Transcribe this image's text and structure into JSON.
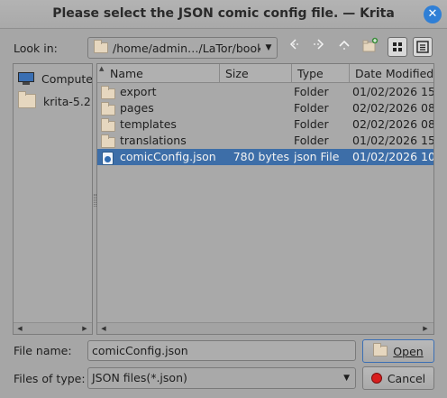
{
  "window": {
    "title": "Please select the JSON comic config file. — Krita",
    "close_glyph": "✕"
  },
  "lookin": {
    "label": "Look in:",
    "path": "/home/admin…/LaTor/book"
  },
  "toolbar": {
    "back": "‹",
    "forward": "›",
    "up": "⌃"
  },
  "places": [
    {
      "label": "Computer",
      "icon": "computer-icon"
    },
    {
      "label": "krita-5.2.",
      "icon": "folder-icon"
    }
  ],
  "columns": {
    "name": "Name",
    "size": "Size",
    "type": "Type",
    "date": "Date Modified"
  },
  "files": [
    {
      "name": "export",
      "size": "",
      "type": "Folder",
      "date": "01/02/2026 15:",
      "icon": "folder-icon",
      "selected": false
    },
    {
      "name": "pages",
      "size": "",
      "type": "Folder",
      "date": "02/02/2026 08:",
      "icon": "folder-icon",
      "selected": false
    },
    {
      "name": "templates",
      "size": "",
      "type": "Folder",
      "date": "02/02/2026 08:",
      "icon": "folder-icon",
      "selected": false
    },
    {
      "name": "translations",
      "size": "",
      "type": "Folder",
      "date": "01/02/2026 15:",
      "icon": "folder-icon",
      "selected": false
    },
    {
      "name": "comicConfig.json",
      "size": "780 bytes",
      "type": "json File",
      "date": "01/02/2026 10:",
      "icon": "json-file-icon",
      "selected": true
    }
  ],
  "filename": {
    "label": "File name:",
    "value": "comicConfig.json"
  },
  "filetype": {
    "label": "Files of type:",
    "value": "JSON files(*.json)"
  },
  "buttons": {
    "open": "Open",
    "cancel": "Cancel"
  },
  "colors": {
    "selection": "#3d6ea8",
    "accent": "#2f7fd6",
    "cancel_icon": "#d81e1e"
  }
}
